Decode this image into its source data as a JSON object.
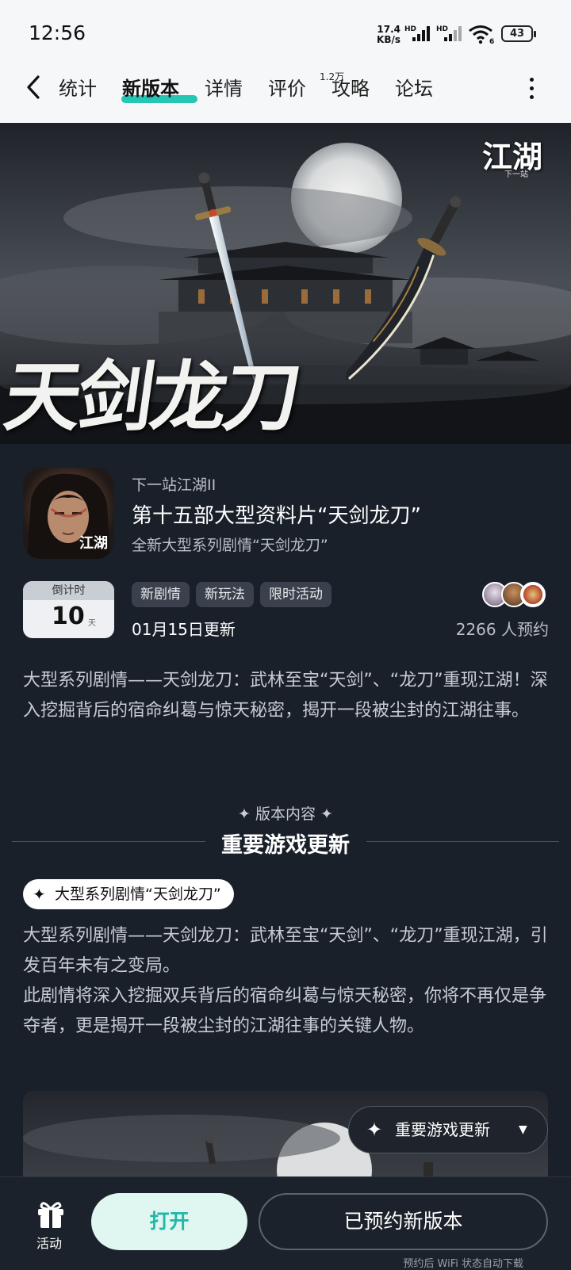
{
  "status_bar": {
    "time": "12:56",
    "net_speed_value": "17.4",
    "net_speed_unit": "KB/s",
    "sim1": "HD",
    "sim2": "HD",
    "wifi_label": "6",
    "battery": "43"
  },
  "nav": {
    "back_icon": "chevron-left-icon",
    "tabs": [
      {
        "label": "统计"
      },
      {
        "label": "新版本",
        "active": true
      },
      {
        "label": "详情"
      },
      {
        "label": "评价",
        "badge": "1.2万"
      },
      {
        "label": "攻略"
      },
      {
        "label": "论坛"
      }
    ],
    "more_icon": "more-vertical-icon",
    "accent_color": "#26c6b5"
  },
  "banner": {
    "title": "天剑龙刀",
    "logo": "江湖",
    "logo_sub": "下一站"
  },
  "app": {
    "icon_logo": "江湖",
    "developer": "下一站江湖II",
    "title": "第十五部大型资料片“天剑龙刀”",
    "subtitle": "全新大型系列剧情“天剑龙刀”"
  },
  "countdown": {
    "label": "倒计时",
    "value": "10",
    "unit": "天"
  },
  "tags": [
    "新剧情",
    "新玩法",
    "限时活动"
  ],
  "update_date": "01月15日更新",
  "reservations": "2266 人预约",
  "description": "大型系列剧情——天剑龙刀：武林至宝“天剑”、“龙刀”重现江湖！深入挖掘背后的宿命纠葛与惊天秘密，揭开一段被尘封的江湖往事。",
  "section": {
    "small_title": "✦ 版本内容 ✦",
    "big_title": "重要游戏更新"
  },
  "item": {
    "pill_label": "大型系列剧情“天剑龙刀”",
    "paragraph_1": "大型系列剧情——天剑龙刀：武林至宝“天剑”、“龙刀”重现江湖，引发百年未有之变局。",
    "paragraph_2": "此剧情将深入挖掘双兵背后的宿命纠葛与惊天秘密，你将不再仅是争夺者，更是揭开一段被尘封的江湖往事的关键人物。"
  },
  "float_button": {
    "label": "重要游戏更新",
    "icon": "sparkle-icon",
    "caret": "▼"
  },
  "bottom": {
    "activity_label": "活动",
    "activity_icon": "gift-icon",
    "open_label": "打开",
    "reserved_label": "已预约新版本",
    "note": "预约后 WiFi 状态自动下载"
  }
}
